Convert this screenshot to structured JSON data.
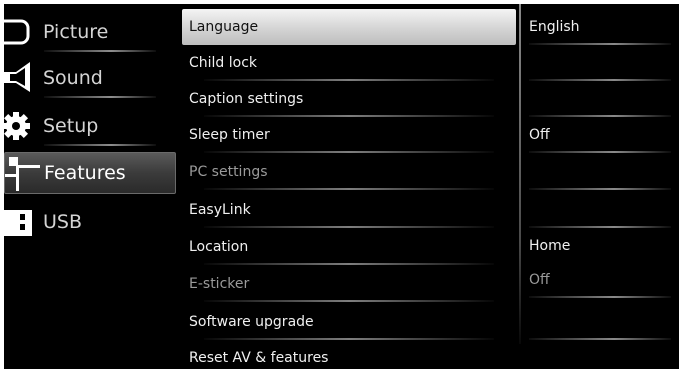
{
  "categories": [
    {
      "label": "Picture",
      "icon": "picture-icon"
    },
    {
      "label": "Sound",
      "icon": "speaker-icon"
    },
    {
      "label": "Setup",
      "icon": "gear-icon"
    },
    {
      "label": "Features",
      "icon": "features-icon"
    },
    {
      "label": "USB",
      "icon": "usb-icon"
    }
  ],
  "active_category": "Features",
  "options": [
    {
      "label": "Language",
      "value": "English",
      "enabled": true
    },
    {
      "label": "Child lock",
      "value": "",
      "enabled": true
    },
    {
      "label": "Caption settings",
      "value": "",
      "enabled": true
    },
    {
      "label": "Sleep timer",
      "value": "Off",
      "enabled": true
    },
    {
      "label": "PC settings",
      "value": "",
      "enabled": false
    },
    {
      "label": "EasyLink",
      "value": "",
      "enabled": true
    },
    {
      "label": "Location",
      "value": "Home",
      "enabled": true
    },
    {
      "label": "E-sticker",
      "value": "Off",
      "enabled": false
    },
    {
      "label": "Software upgrade",
      "value": "",
      "enabled": true
    },
    {
      "label": "Reset AV & features",
      "value": "",
      "enabled": true
    }
  ],
  "active_option": "Language",
  "colors": {
    "background": "#000000",
    "text": "#f0f0f0",
    "dimmed_text": "#9a9a9a",
    "highlight": "#dcdcdc"
  }
}
